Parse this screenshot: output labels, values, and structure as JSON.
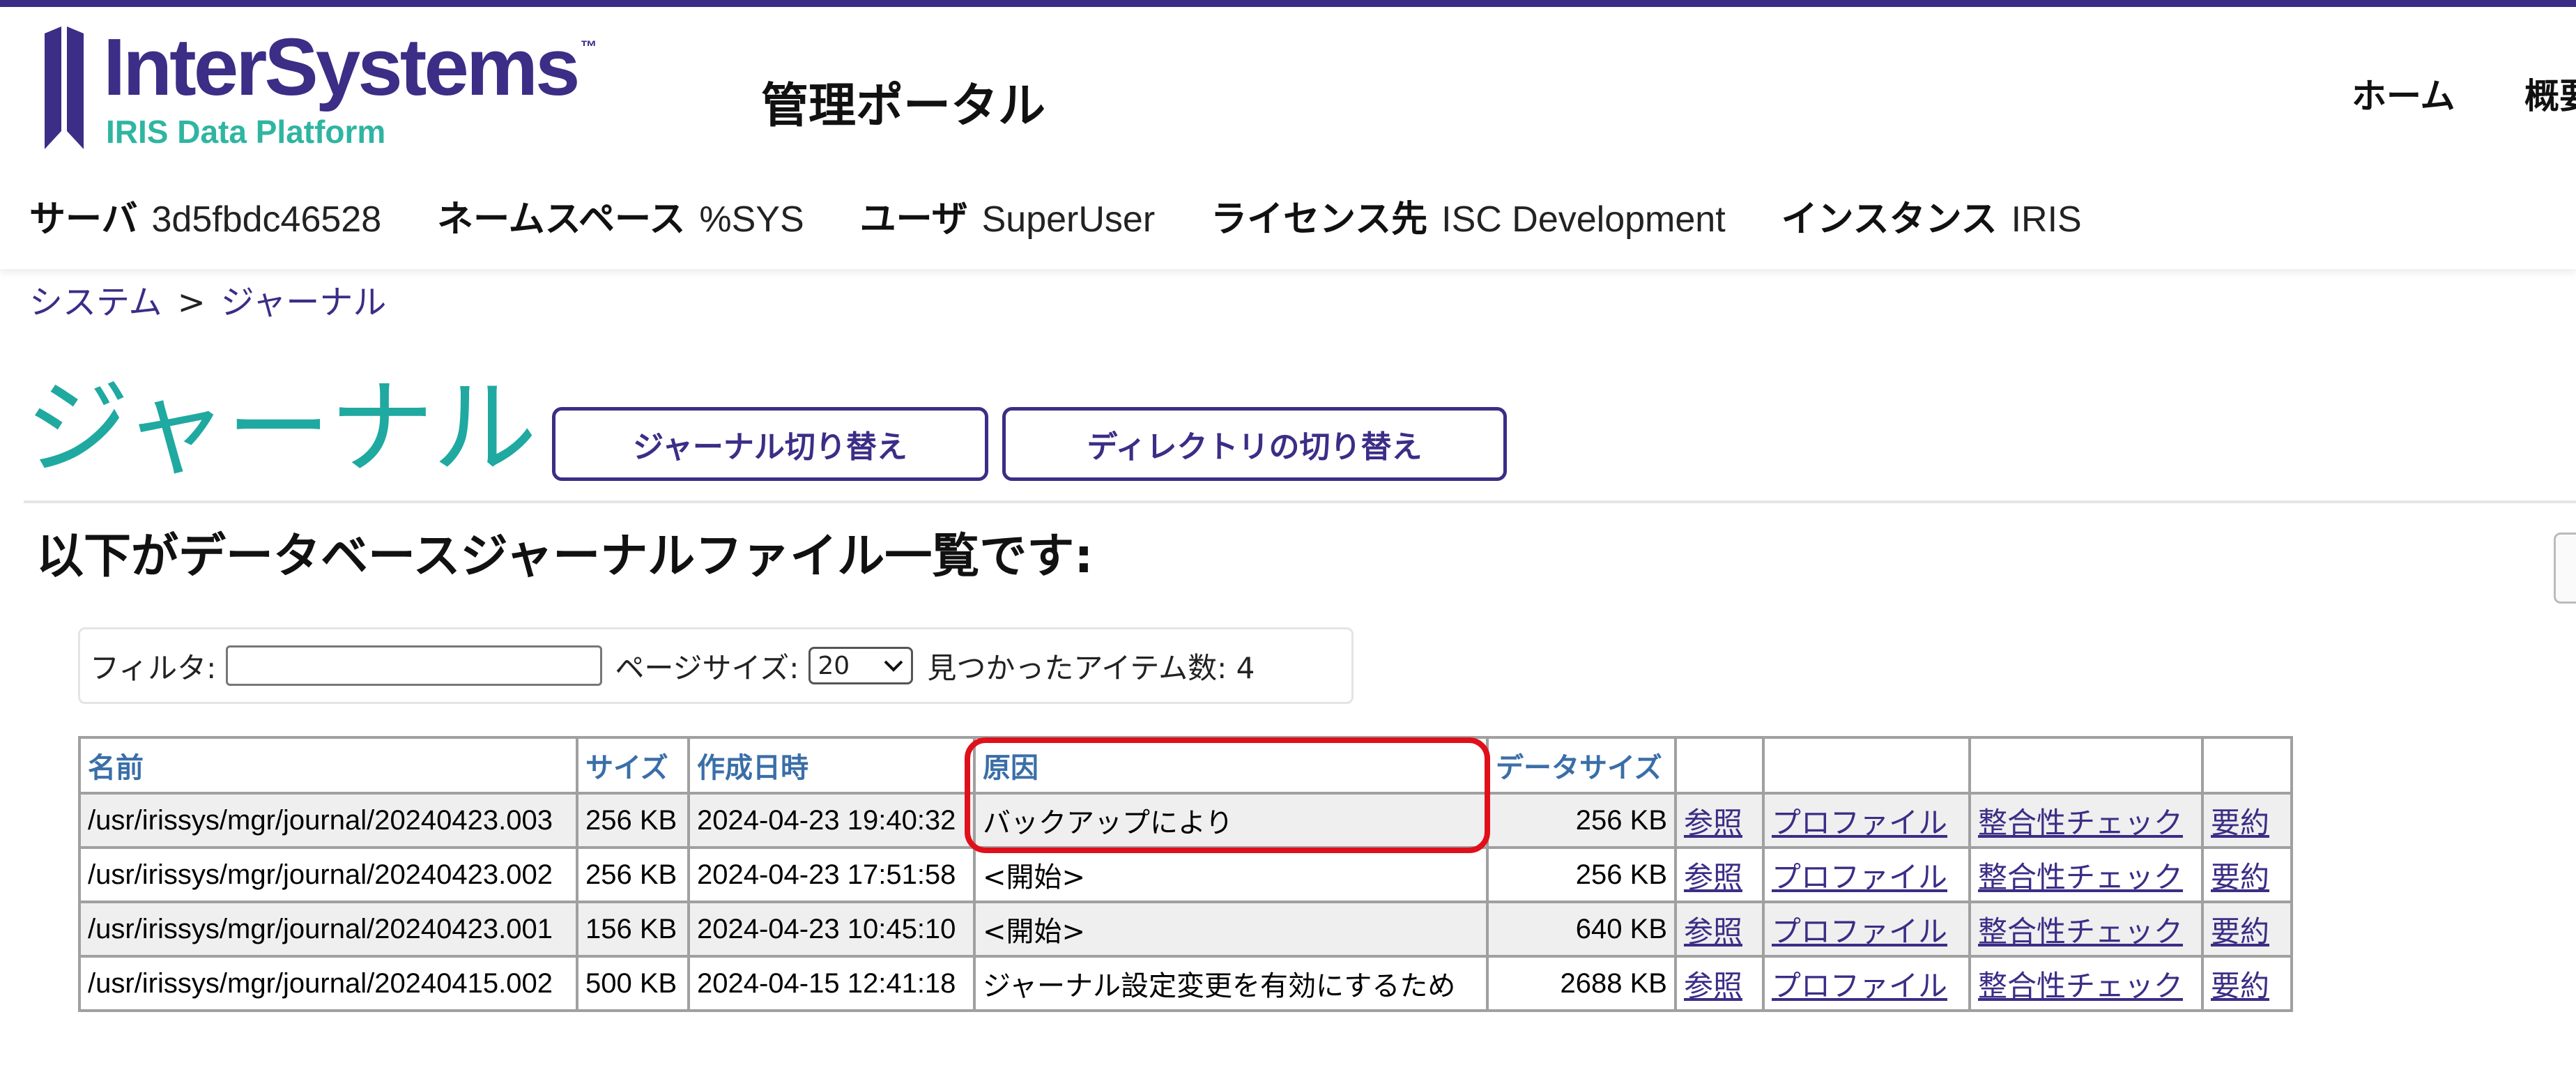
{
  "brand": {
    "name": "InterSystems",
    "tm": "™",
    "product": "IRIS Data Platform",
    "color_primary": "#3c2d86",
    "color_accent": "#20a9a0"
  },
  "header": {
    "portal_title": "管理ポータル",
    "nav": {
      "home": "ホーム",
      "overview": "概要"
    }
  },
  "info": {
    "server_label": "サーバ",
    "server_value": "3d5fbdc46528",
    "namespace_label": "ネームスペース",
    "namespace_value": "%SYS",
    "user_label": "ユーザ",
    "user_value": "SuperUser",
    "license_label": "ライセンス先",
    "license_value": "ISC Development",
    "instance_label": "インスタンス",
    "instance_value": "IRIS"
  },
  "breadcrumb": {
    "system": "システム",
    "separator": ">",
    "current": "ジャーナル"
  },
  "page": {
    "title": "ジャーナル",
    "switch_journal_button": "ジャーナル切り替え",
    "switch_directory_button": "ディレクトリの切り替え",
    "subtitle": "以下がデータベースジャーナルファイル一覧です:"
  },
  "filter": {
    "filter_label": "フィルタ:",
    "filter_value": "",
    "page_size_label": "ページサイズ:",
    "page_size_value": "20",
    "found_label": "見つかったアイテム数: 4"
  },
  "table": {
    "headers": {
      "name": "名前",
      "size": "サイズ",
      "created": "作成日時",
      "reason": "原因",
      "data_size": "データサイズ"
    },
    "rows": [
      {
        "name": "/usr/irissys/mgr/journal/20240423.003",
        "size": "256 KB",
        "created": "2024-04-23 19:40:32",
        "reason": "バックアップにより",
        "data_size": "256 KB",
        "view": "参照",
        "profile": "プロファイル",
        "integrity": "整合性チェック",
        "summary": "要約"
      },
      {
        "name": "/usr/irissys/mgr/journal/20240423.002",
        "size": "256 KB",
        "created": "2024-04-23 17:51:58",
        "reason": "<開始>",
        "data_size": "256 KB",
        "view": "参照",
        "profile": "プロファイル",
        "integrity": "整合性チェック",
        "summary": "要約"
      },
      {
        "name": "/usr/irissys/mgr/journal/20240423.001",
        "size": "156 KB",
        "created": "2024-04-23 10:45:10",
        "reason": "<開始>",
        "data_size": "640 KB",
        "view": "参照",
        "profile": "プロファイル",
        "integrity": "整合性チェック",
        "summary": "要約"
      },
      {
        "name": "/usr/irissys/mgr/journal/20240415.002",
        "size": "500 KB",
        "created": "2024-04-15 12:41:18",
        "reason": "ジャーナル設定変更を有効にするため",
        "data_size": "2688 KB",
        "view": "参照",
        "profile": "プロファイル",
        "integrity": "整合性チェック",
        "summary": "要約"
      }
    ]
  },
  "annotation": {
    "highlight_color": "#e0101a"
  }
}
